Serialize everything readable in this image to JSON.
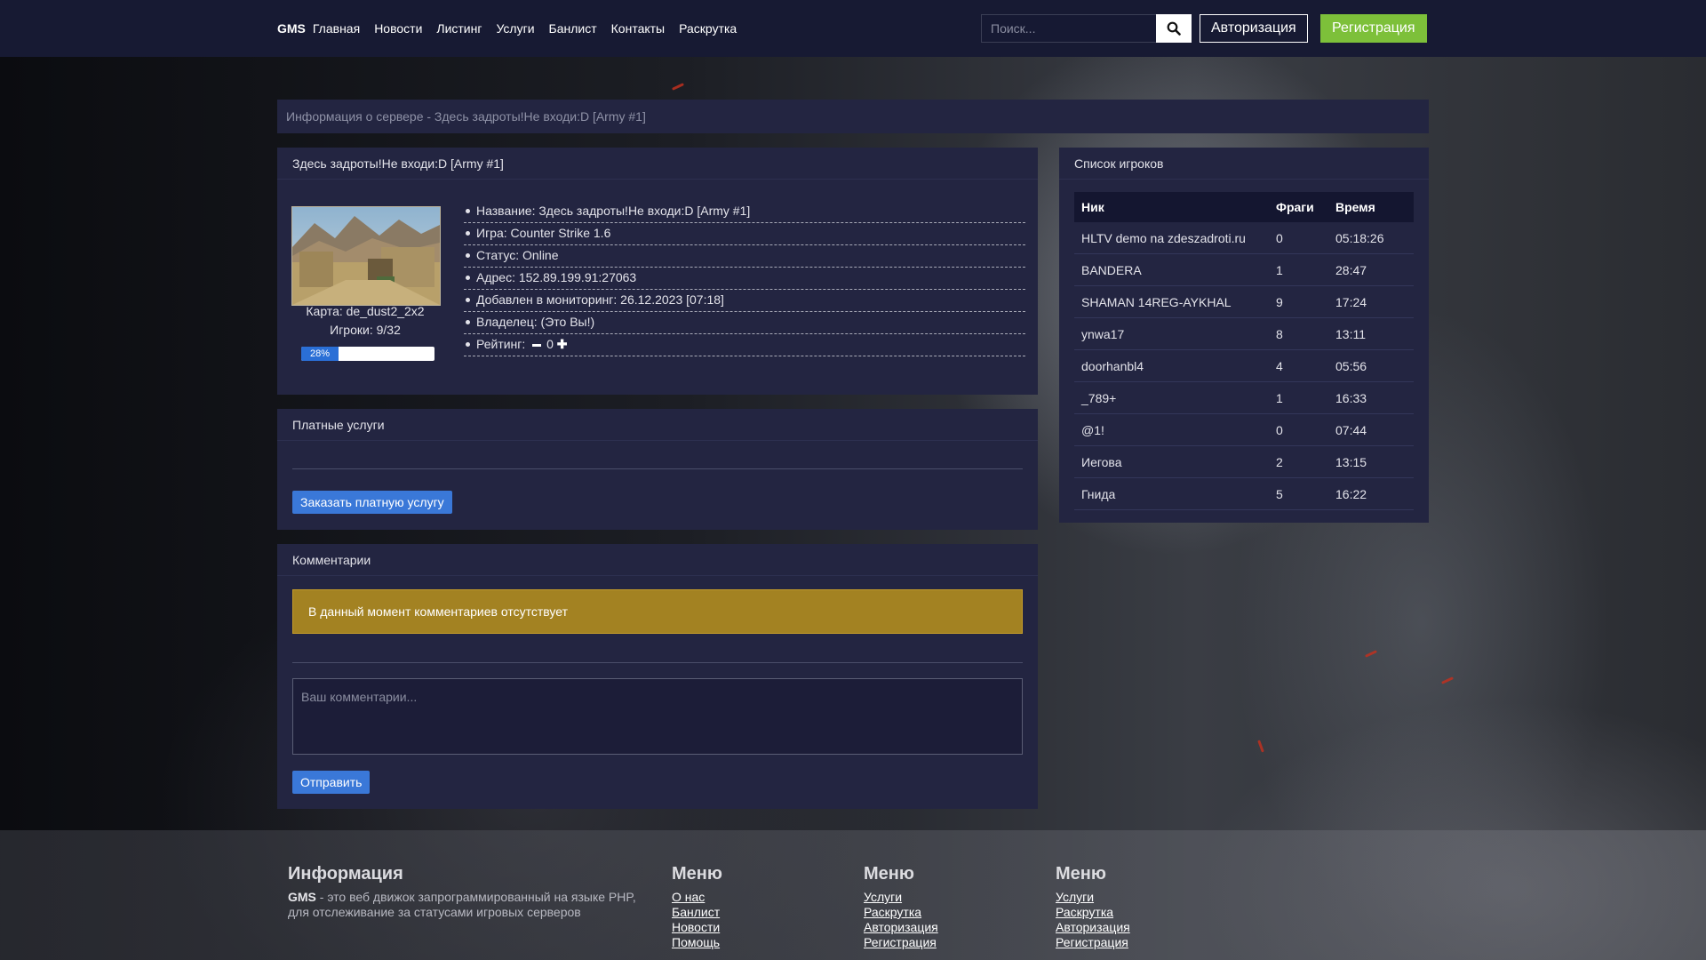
{
  "nav": {
    "brand": "GMS",
    "links": [
      "Главная",
      "Новости",
      "Листинг",
      "Услуги",
      "Банлист",
      "Контакты",
      "Раскрутка"
    ],
    "search_placeholder": "Поиск...",
    "login_label": "Авторизация",
    "register_label": "Регистрация"
  },
  "breadcrumb": "Информация о сервере - Здесь задроты!Не входи:D [Army #1]",
  "server": {
    "title": "Здесь задроты!Не входи:D [Army #1]",
    "map_caption": "Карта: de_dust2_2x2",
    "players_caption": "Игроки: 9/32",
    "load_percent": 28,
    "load_label": "28%",
    "info": [
      "Название: Здесь задроты!Не входи:D [Army #1]",
      "Игра: Counter Strike 1.6",
      "Статус: Online",
      "Адрес: 152.89.199.91:27063",
      "Добавлен в мониторинг: 26.12.2023 [07:18]",
      "Владелец: (Это Вы!)"
    ],
    "rating_label": "Рейтинг:",
    "rating_value": "0"
  },
  "paid": {
    "title": "Платные услуги",
    "order_label": "Заказать платную услугу"
  },
  "comments": {
    "title": "Комментарии",
    "empty_notice": "В данный момент комментариев отсутствует",
    "placeholder": "Ваш комментарии...",
    "send_label": "Отправить"
  },
  "players": {
    "title": "Список игроков",
    "columns": [
      "Ник",
      "Фраги",
      "Время"
    ],
    "rows": [
      [
        "HLTV demo na zdeszadroti.ru",
        "0",
        "05:18:26"
      ],
      [
        "BANDERA",
        "1",
        "28:47"
      ],
      [
        "SHAMAN 14REG-AYKHAL",
        "9",
        "17:24"
      ],
      [
        "ynwa17",
        "8",
        "13:11"
      ],
      [
        "doorhanbl4",
        "4",
        "05:56"
      ],
      [
        "_789+",
        "1",
        "16:33"
      ],
      [
        "@1!",
        "0",
        "07:44"
      ],
      [
        "Иегова",
        "2",
        "13:15"
      ],
      [
        "Гнида",
        "5",
        "16:22"
      ]
    ]
  },
  "footer": {
    "info_title": "Информация",
    "info_brand": "GMS",
    "info_text": " - это веб движок запрограммированный на языке PHP, для отслеживание за статусами игровых серверов",
    "menu1": {
      "title": "Меню",
      "links": [
        "О нас",
        "Банлист",
        "Новости",
        "Помощь"
      ]
    },
    "menu2": {
      "title": "Меню",
      "links": [
        "Услуги",
        "Раскрутка",
        "Авторизация",
        "Регистрация"
      ]
    },
    "menu3": {
      "title": "Меню",
      "links": [
        "Услуги",
        "Раскрутка",
        "Авторизация",
        "Регистрация"
      ]
    }
  },
  "colors": {
    "navbar": "#171a33",
    "panel": "#232541",
    "accent_green": "#7dc03a",
    "accent_blue": "#3a78d8",
    "alert": "#a38222"
  }
}
